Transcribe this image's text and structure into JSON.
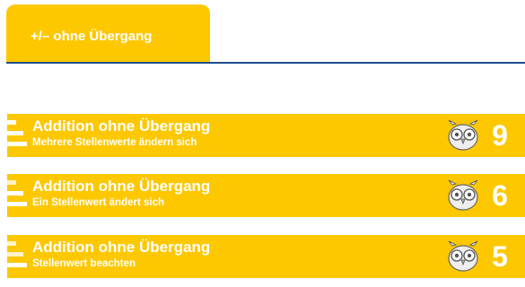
{
  "tab": {
    "label": "+/– ohne Übergang"
  },
  "colors": {
    "accent": "#fdc800",
    "divider": "#1f4e8c",
    "text": "#ffffff"
  },
  "rows": [
    {
      "title": "Addition ohne Übergang",
      "subtitle": "Mehrere Stellenwerte ändern sich",
      "count": "9",
      "icon": "owl-icon",
      "level": 3
    },
    {
      "title": "Addition ohne Übergang",
      "subtitle": "Ein Stellenwert ändert sich",
      "count": "6",
      "icon": "owl-icon",
      "level": 2
    },
    {
      "title": "Addition ohne Übergang",
      "subtitle": "Stellenwert beachten",
      "count": "5",
      "icon": "owl-icon",
      "level": 1
    }
  ]
}
